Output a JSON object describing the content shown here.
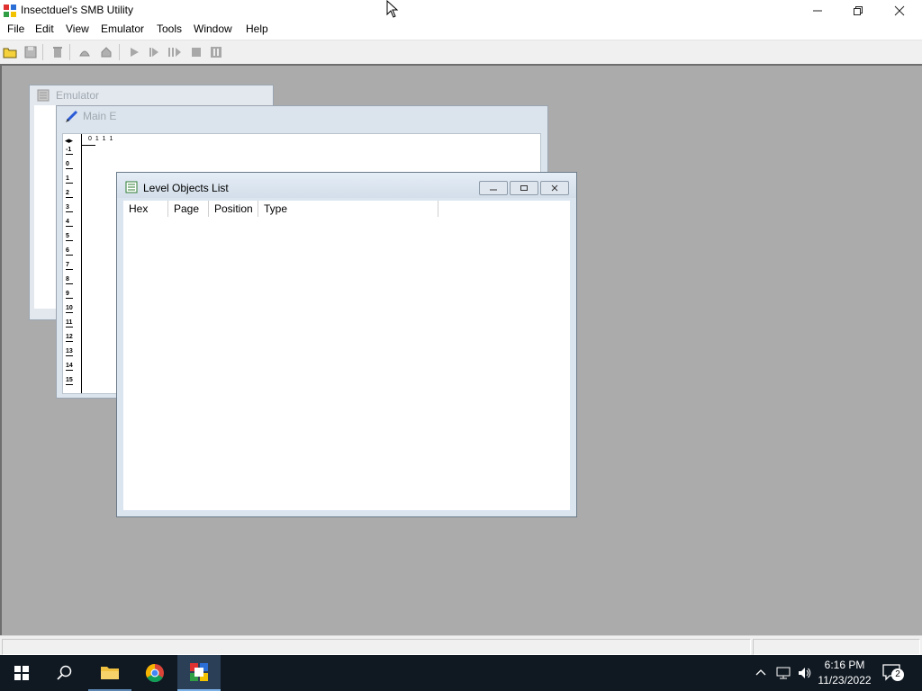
{
  "window": {
    "title": "Insectduel's SMB Utility"
  },
  "menu": [
    "File",
    "Edit",
    "View",
    "Emulator",
    "Tools",
    "Window",
    "Help"
  ],
  "children": {
    "emulator_title": "Emulator",
    "main_editor_title": "Main E",
    "ruler_top": "0 1 1 1",
    "ruler_rows": [
      "-1",
      "0",
      "1",
      "2",
      "3",
      "4",
      "5",
      "6",
      "7",
      "8",
      "9",
      "10",
      "11",
      "12",
      "13",
      "14",
      "15"
    ],
    "list_title": "Level Objects List",
    "columns": [
      "Hex",
      "Page",
      "Position",
      "Type"
    ]
  },
  "taskbar": {
    "time": "6:16 PM",
    "date": "11/23/2022",
    "notification_count": "2"
  },
  "colors": {
    "mdi_background": "#ababab",
    "taskbar": "#101922",
    "accent": "#0078d7"
  }
}
